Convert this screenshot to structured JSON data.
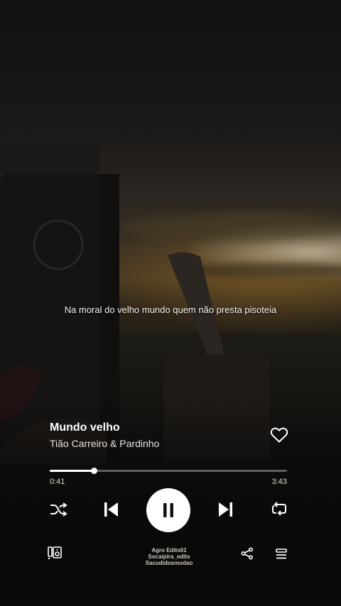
{
  "lyric": "Na moral do velho mundo quem não presta pisoteia",
  "track": {
    "title": "Mundo velho",
    "artist": "Tião Carreiro & Pardinho",
    "elapsed": "0:41",
    "duration": "3:43",
    "progress_fraction": 0.186,
    "liked": false
  },
  "controls": {
    "shuffle_icon": "shuffle-icon",
    "previous_icon": "skip-previous-icon",
    "play_state": "playing",
    "next_icon": "skip-next-icon",
    "repeat_icon": "repeat-icon",
    "devices_icon": "connect-device-icon",
    "share_icon": "share-icon",
    "queue_icon": "queue-icon"
  },
  "watermark": {
    "line1": "Agro Edits01",
    "line2": "Socaipira_edits",
    "line3": "Sacudidosmodao"
  },
  "colors": {
    "foreground": "#ffffff",
    "track_inactive": "#5a5753",
    "background": "#0d0b0a"
  }
}
